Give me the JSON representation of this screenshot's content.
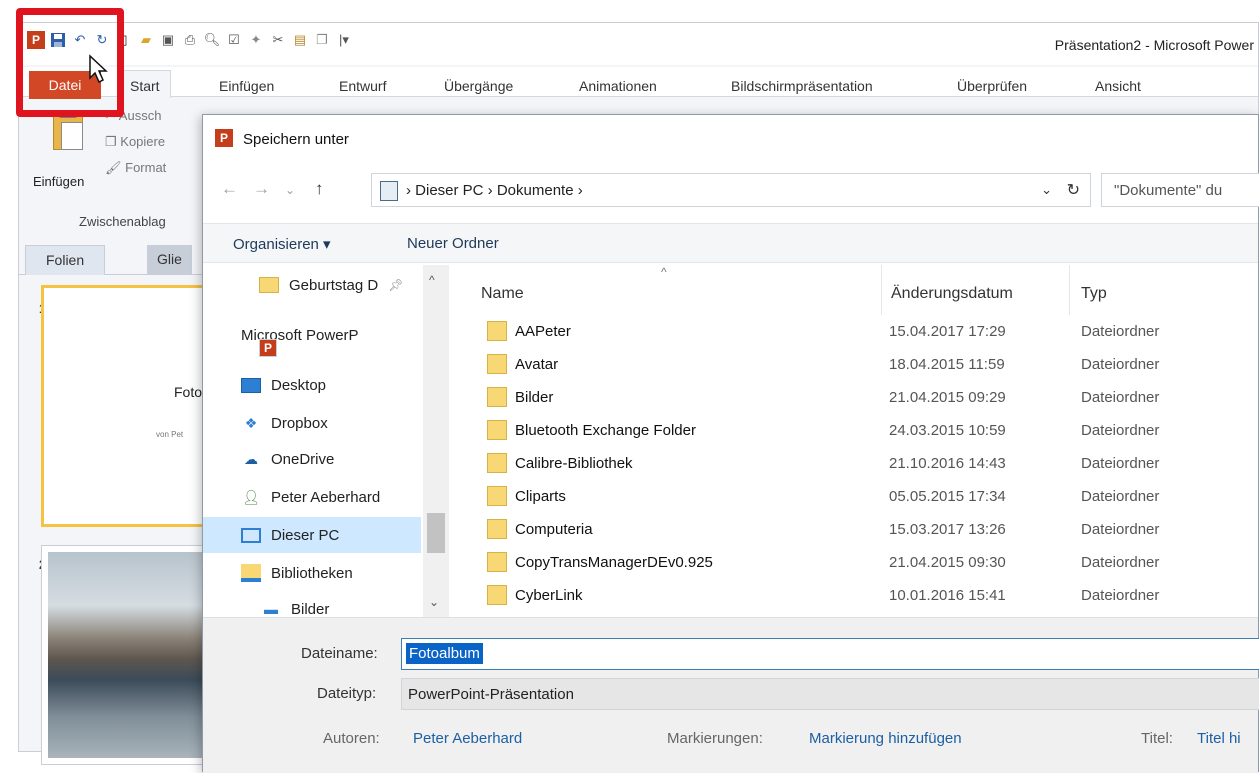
{
  "window": {
    "title": "Präsentation2 - Microsoft Power"
  },
  "qat": {
    "logo": "P",
    "icons": [
      "powerpoint-logo",
      "save-icon",
      "undo-icon",
      "redo-icon",
      "new-icon",
      "open-icon",
      "publish-icon",
      "print-icon",
      "print-preview-icon",
      "spelling-icon",
      "animation-icon",
      "cut-icon",
      "paste-icon",
      "copy-icon",
      "customize-icon"
    ]
  },
  "ribbon": {
    "tabs": [
      "Datei",
      "Start",
      "Einfügen",
      "Entwurf",
      "Übergänge",
      "Animationen",
      "Bildschirmpräsentation",
      "Überprüfen",
      "Ansicht"
    ],
    "clipboard": {
      "paste": "Einfügen",
      "cut": "Aussch",
      "copy": "Kopiere",
      "format": "Format",
      "group": "Zwischenablag"
    }
  },
  "slides_panel": {
    "tabs": [
      "Folien",
      "Glie"
    ],
    "slide1": {
      "number": "1",
      "title": "Foto",
      "subtitle": "von Pet"
    },
    "slide2": {
      "number": "2"
    }
  },
  "dialog": {
    "title": "Speichern unter",
    "breadcrumb": "›  Dieser PC  ›  Dokumente  ›",
    "search_placeholder": "\"Dokumente\" du",
    "organize": "Organisieren ▾",
    "new_folder": "Neuer Ordner",
    "nav": [
      {
        "label": "Geburtstag D",
        "icon": "folder-icon"
      },
      {
        "label": "Microsoft PowerP",
        "icon": "powerpoint-icon"
      },
      {
        "label": "Desktop",
        "icon": "desktop-icon"
      },
      {
        "label": "Dropbox",
        "icon": "dropbox-icon"
      },
      {
        "label": "OneDrive",
        "icon": "onedrive-icon"
      },
      {
        "label": "Peter Aeberhard",
        "icon": "user-icon"
      },
      {
        "label": "Dieser PC",
        "icon": "computer-icon"
      },
      {
        "label": "Bibliotheken",
        "icon": "libraries-icon"
      },
      {
        "label": "Bilder",
        "icon": "pictures-icon"
      }
    ],
    "columns": {
      "name": "Name",
      "date": "Änderungsdatum",
      "type": "Typ"
    },
    "files": [
      {
        "name": "AAPeter",
        "date": "15.04.2017 17:29",
        "type": "Dateiordner"
      },
      {
        "name": "Avatar",
        "date": "18.04.2015 11:59",
        "type": "Dateiordner"
      },
      {
        "name": "Bilder",
        "date": "21.04.2015 09:29",
        "type": "Dateiordner"
      },
      {
        "name": "Bluetooth Exchange Folder",
        "date": "24.03.2015 10:59",
        "type": "Dateiordner"
      },
      {
        "name": "Calibre-Bibliothek",
        "date": "21.10.2016 14:43",
        "type": "Dateiordner"
      },
      {
        "name": "Cliparts",
        "date": "05.05.2015 17:34",
        "type": "Dateiordner"
      },
      {
        "name": "Computeria",
        "date": "15.03.2017 13:26",
        "type": "Dateiordner"
      },
      {
        "name": "CopyTransManagerDEv0.925",
        "date": "21.04.2015 09:30",
        "type": "Dateiordner"
      },
      {
        "name": "CyberLink",
        "date": "10.01.2016 15:41",
        "type": "Dateiordner"
      }
    ],
    "filename_label": "Dateiname:",
    "filename_value": "Fotoalbum",
    "filetype_label": "Dateityp:",
    "filetype_value": "PowerPoint-Präsentation",
    "authors_label": "Autoren:",
    "authors_value": "Peter Aeberhard",
    "tags_label": "Markierungen:",
    "tags_value": "Markierung hinzufügen",
    "title_label": "Titel:",
    "title_value": "Titel hi"
  },
  "colors": {
    "file_tab": "#d24726",
    "highlight": "#e0141f",
    "selection": "#0a64c8"
  }
}
